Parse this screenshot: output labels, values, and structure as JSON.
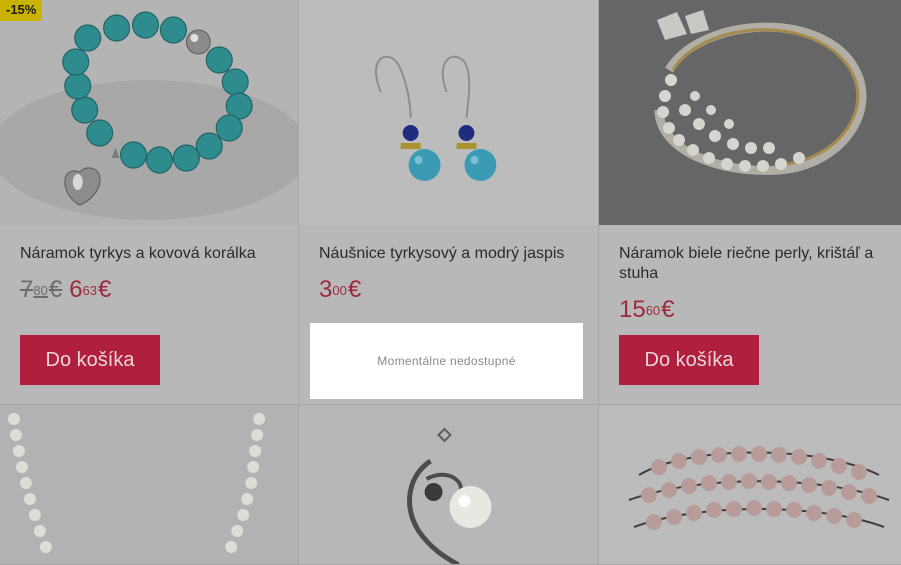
{
  "products": [
    {
      "name": "Náramok tyrkys a kovová korálka",
      "badge": "-15%",
      "old_price": {
        "whole": "7",
        "cents": "80",
        "currency": "€"
      },
      "price": {
        "whole": "6",
        "cents": "63",
        "currency": "€"
      },
      "button": "Do košíka"
    },
    {
      "name": "Náušnice tyrkysový a modrý jaspis",
      "price": {
        "whole": "3",
        "cents": "00",
        "currency": "€"
      },
      "availability": "Momentálne nedostupné"
    },
    {
      "name": "Náramok biele riečne perly, krištáľ a stuha",
      "price": {
        "whole": "15",
        "cents": "60",
        "currency": "€"
      },
      "button": "Do košíka"
    },
    {
      "image": "pearl-necklace"
    },
    {
      "image": "pearl-pendant"
    },
    {
      "image": "pearl-wrap-bracelet"
    }
  ],
  "colors": {
    "accent": "#b01f3e",
    "price": "#9d2a3c",
    "badge": "#c9b200"
  }
}
